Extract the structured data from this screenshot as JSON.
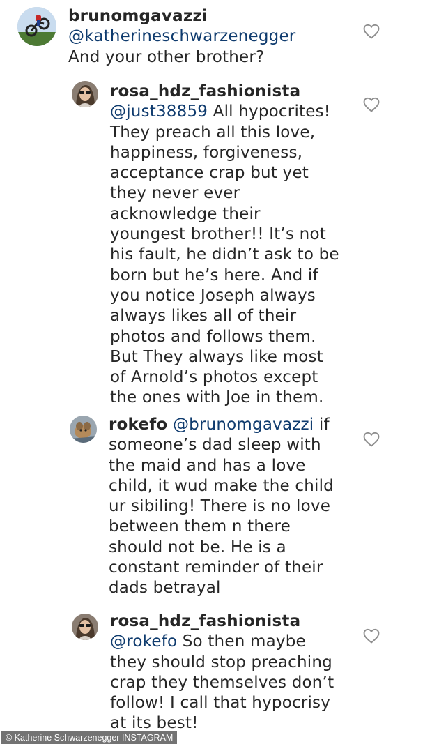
{
  "comments": [
    {
      "username": "brunomgavazzi",
      "mention": "@katherineschwarzenegger",
      "body": "And your other brother?",
      "avatar_icon": "motorcycle-avatar-icon",
      "like_icon": "heart-outline-icon"
    },
    {
      "username": "rosa_hdz_fashionista",
      "mention": "@just38859",
      "body": " All hypocrites!\nThey preach all this love,\nhappiness, forgiveness,\nacceptance crap but yet\nthey never ever\nacknowledge their\nyoungest brother!! It’s not\nhis fault, he didn’t ask to be\nborn but he’s here. And if\nyou notice Joseph always\nalways likes all of their\nphotos and follows them.\nBut They always like most\nof Arnold’s photos except\nthe ones with Joe in them.",
      "avatar_icon": "profile-photo-avatar-icon",
      "like_icon": "heart-outline-icon"
    },
    {
      "username": "rokefo",
      "mention": "@brunomgavazzi",
      "body": "  if\nsomeone’s dad sleep with\nthe maid and has a love\nchild, it wud make the child\nur sibiling!  There is no love\nbetween them n there\nshould not be. He is a\nconstant reminder of their\ndads betrayal",
      "avatar_icon": "dog-photo-avatar-icon",
      "like_icon": "heart-outline-icon"
    },
    {
      "username": "rosa_hdz_fashionista",
      "mention": "@rokefo",
      "body": " So then maybe\nthey should stop preaching\ncrap they themselves don’t\nfollow! I call that hypocrisy\nat its best!",
      "avatar_icon": "profile-photo-avatar-icon",
      "like_icon": "heart-outline-icon"
    }
  ],
  "credit": "© Katherine Schwarzenegger INSTAGRAM",
  "colors": {
    "text": "#262626",
    "mention": "#0f3b6e",
    "heart": "#8e8e8e",
    "background": "#ffffff"
  }
}
